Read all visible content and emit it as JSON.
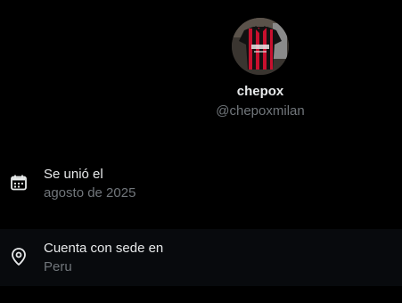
{
  "profile": {
    "display_name": "chepox",
    "handle": "@chepoxmilan",
    "avatar_icon": "jersey-avatar"
  },
  "about": {
    "joined": {
      "icon": "calendar-icon",
      "label": "Se unió el",
      "value": "agosto de 2025"
    },
    "location": {
      "icon": "location-pin-icon",
      "label": "Cuenta con sede en",
      "value": "Peru"
    }
  },
  "colors": {
    "background": "#000000",
    "text_primary": "#e7e9ea",
    "text_secondary": "#71767b",
    "row_highlight": "#080a0d",
    "jersey_red": "#c8102e",
    "jersey_black": "#111111"
  }
}
